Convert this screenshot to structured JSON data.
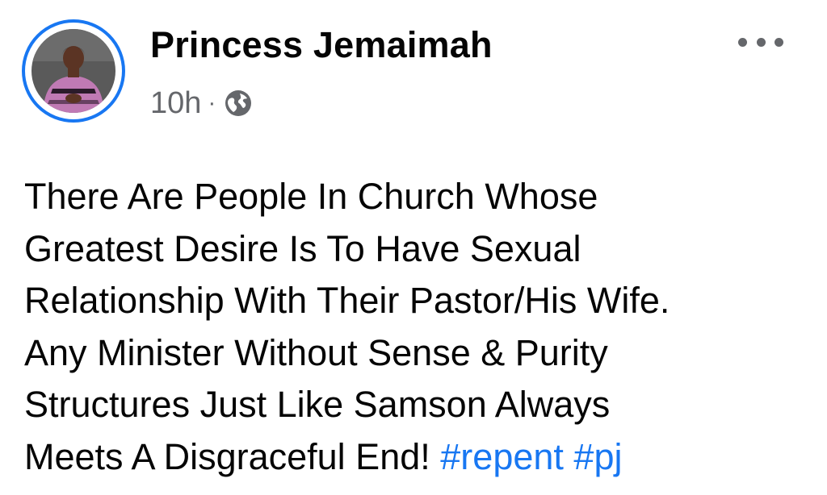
{
  "post": {
    "author": "Princess Jemaimah",
    "timestamp": "10h",
    "separator": "·",
    "audience_icon": "globe-icon",
    "more_icon": "more-options-icon",
    "avatar_icon": "profile-photo",
    "text_lines": [
      "There Are People In Church Whose",
      "Greatest Desire Is To Have Sexual",
      "Relationship With Their Pastor/His Wife.",
      "Any Minister Without Sense & Purity",
      "Structures Just Like Samson Always",
      "Meets A Disgraceful End!"
    ],
    "hashtags": [
      "#repent",
      "#pj"
    ]
  },
  "colors": {
    "accent": "#1877f2",
    "text": "#050505",
    "secondary_text": "#65676b",
    "background": "#ffffff"
  }
}
